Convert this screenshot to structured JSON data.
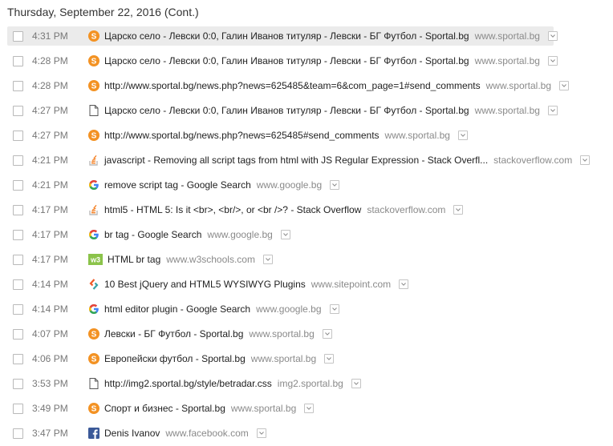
{
  "day_header": "Thursday, September 22, 2016 (Cont.)",
  "entries": [
    {
      "time": "4:31 PM",
      "icon": "sportal-icon",
      "title": "Царско село - Левски 0:0, Галин Иванов титуляр - Левски - БГ Футбол - Sportal.bg",
      "domain": "www.sportal.bg",
      "hover": true
    },
    {
      "time": "4:28 PM",
      "icon": "sportal-icon",
      "title": "Царско село - Левски 0:0, Галин Иванов титуляр - Левски - БГ Футбол - Sportal.bg",
      "domain": "www.sportal.bg"
    },
    {
      "time": "4:28 PM",
      "icon": "sportal-icon",
      "title": "http://www.sportal.bg/news.php?news=625485&team=6&com_page=1#send_comments",
      "domain": "www.sportal.bg"
    },
    {
      "time": "4:27 PM",
      "icon": "page-icon",
      "title": "Царско село - Левски 0:0, Галин Иванов титуляр - Левски - БГ Футбол - Sportal.bg",
      "domain": "www.sportal.bg"
    },
    {
      "time": "4:27 PM",
      "icon": "sportal-icon",
      "title": "http://www.sportal.bg/news.php?news=625485#send_comments",
      "domain": "www.sportal.bg"
    },
    {
      "time": "4:21 PM",
      "icon": "stackoverflow-icon",
      "title": "javascript - Removing all script tags from html with JS Regular Expression - Stack Overfl...",
      "domain": "stackoverflow.com"
    },
    {
      "time": "4:21 PM",
      "icon": "google-icon",
      "title": "remove script tag - Google Search",
      "domain": "www.google.bg"
    },
    {
      "time": "4:17 PM",
      "icon": "stackoverflow-icon",
      "title": "html5 - HTML 5: Is it <br>, <br/>, or <br />? - Stack Overflow",
      "domain": "stackoverflow.com"
    },
    {
      "time": "4:17 PM",
      "icon": "google-icon",
      "title": "br tag - Google Search",
      "domain": "www.google.bg"
    },
    {
      "time": "4:17 PM",
      "icon": "w3schools-icon",
      "title": "HTML br tag",
      "domain": "www.w3schools.com"
    },
    {
      "time": "4:14 PM",
      "icon": "sitepoint-icon",
      "title": "10 Best jQuery and HTML5 WYSIWYG Plugins",
      "domain": "www.sitepoint.com"
    },
    {
      "time": "4:14 PM",
      "icon": "google-icon",
      "title": "html editor plugin - Google Search",
      "domain": "www.google.bg"
    },
    {
      "time": "4:07 PM",
      "icon": "sportal-icon",
      "title": "Левски - БГ Футбол - Sportal.bg",
      "domain": "www.sportal.bg"
    },
    {
      "time": "4:06 PM",
      "icon": "sportal-icon",
      "title": "Европейски футбол - Sportal.bg",
      "domain": "www.sportal.bg"
    },
    {
      "time": "3:53 PM",
      "icon": "page-icon",
      "title": "http://img2.sportal.bg/style/betradar.css",
      "domain": "img2.sportal.bg"
    },
    {
      "time": "3:49 PM",
      "icon": "sportal-icon",
      "title": "Спорт и бизнес - Sportal.bg",
      "domain": "www.sportal.bg"
    },
    {
      "time": "3:47 PM",
      "icon": "facebook-icon",
      "title": "Denis Ivanov",
      "domain": "www.facebook.com"
    }
  ],
  "colors": {
    "sportal": "#f39223",
    "stackoverflow": "#f48024",
    "facebook": "#3b5998",
    "w3schools": "#8bc34a",
    "hover_bg": "#ebebeb"
  }
}
